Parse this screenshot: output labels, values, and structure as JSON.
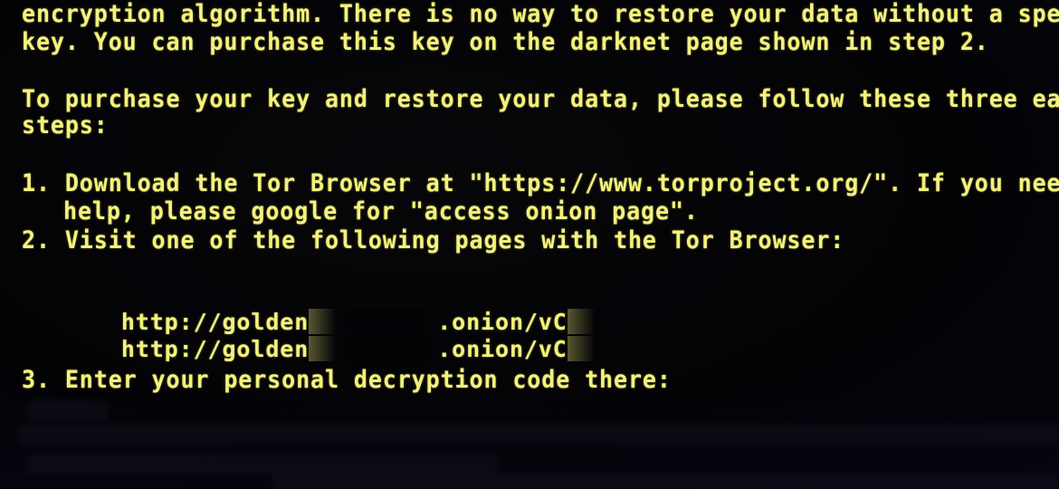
{
  "screen": {
    "text_color": "#f4f27c",
    "background_color": "#020204",
    "lines": {
      "l1": "encryption algorithm. There is no way to restore your data without a spe",
      "l2": "key. You can purchase this key on the darknet page shown in step 2.",
      "l3": "To purchase your key and restore your data, please follow these three ea",
      "l4": "steps:",
      "step1_a": "1. Download the Tor Browser at \"https://www.torproject.org/\". If you nee",
      "step1_b": "help, please google for \"access onion page\".",
      "step2": "2. Visit one of the following pages with the Tor Browser:",
      "step3": "3. Enter your personal decryption code there:"
    },
    "urls": [
      {
        "prefix": "http://golden",
        "suffix": ".onion/vC",
        "redacted": true
      },
      {
        "prefix": "http://golden",
        "suffix": ".onion/vC",
        "redacted": true
      }
    ],
    "decryption_code": {
      "visible": false,
      "note": "obscured"
    }
  }
}
